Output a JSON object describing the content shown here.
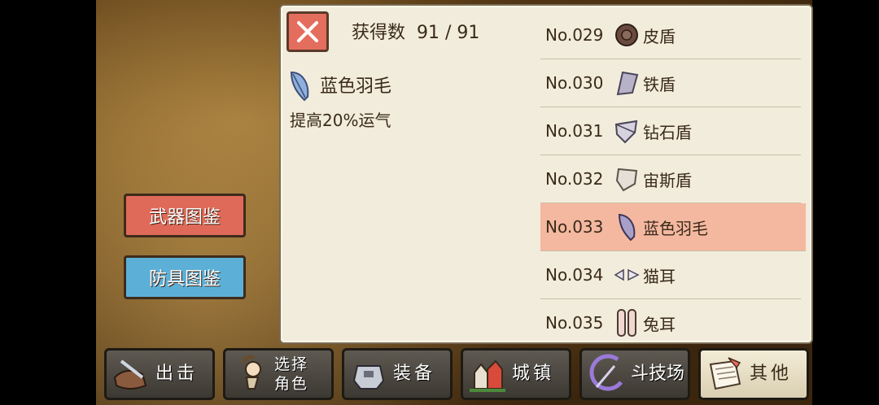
{
  "header": {
    "count_label": "获得数",
    "count_value": "91 / 91"
  },
  "detail": {
    "name": "蓝色羽毛",
    "description": "提高20%运气",
    "icon": "feather-icon"
  },
  "list": [
    {
      "no": "No.029",
      "name": "皮盾",
      "icon": "leather-shield-icon"
    },
    {
      "no": "No.030",
      "name": "铁盾",
      "icon": "iron-shield-icon"
    },
    {
      "no": "No.031",
      "name": "钻石盾",
      "icon": "diamond-shield-icon"
    },
    {
      "no": "No.032",
      "name": "宙斯盾",
      "icon": "zeus-shield-icon"
    },
    {
      "no": "No.033",
      "name": "蓝色羽毛",
      "icon": "feather-icon",
      "selected": true
    },
    {
      "no": "No.034",
      "name": "猫耳",
      "icon": "cat-ears-icon"
    },
    {
      "no": "No.035",
      "name": "兔耳",
      "icon": "bunny-ears-icon"
    }
  ],
  "side": {
    "weapons_label": "武器图鉴",
    "armor_label": "防具图鉴"
  },
  "tabs": [
    {
      "label": "出击",
      "icon": "sortie-icon"
    },
    {
      "label_line1": "选择",
      "label_line2": "角色",
      "icon": "character-icon"
    },
    {
      "label": "装备",
      "icon": "equipment-icon"
    },
    {
      "label": "城镇",
      "icon": "town-icon"
    },
    {
      "label": "斗技场",
      "icon": "arena-icon"
    },
    {
      "label": "其他",
      "icon": "scroll-icon",
      "active": true
    }
  ],
  "colors": {
    "selected_row": "#f4b8a0",
    "weapons_button": "#e06a5a",
    "armor_button": "#5cb0d8",
    "close_button": "#e46e5e"
  }
}
